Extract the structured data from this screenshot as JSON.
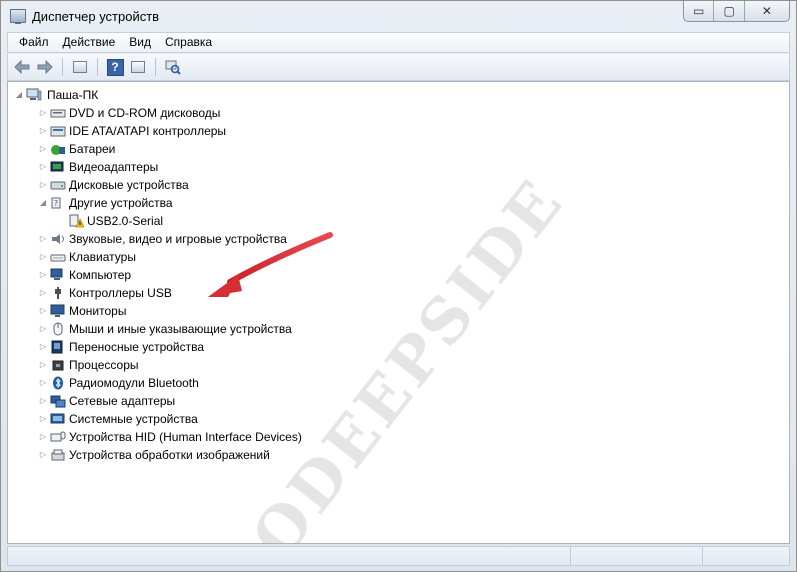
{
  "window": {
    "title": "Диспетчер устройств"
  },
  "caption_buttons": {
    "minimize": "▭",
    "maximize": "▢",
    "close": "✕"
  },
  "menu": [
    "Файл",
    "Действие",
    "Вид",
    "Справка"
  ],
  "toolbar": {
    "buttons": [
      "back-icon",
      "forward-icon",
      "properties-icon",
      "help-icon",
      "update-driver-icon",
      "scan-hardware-icon"
    ]
  },
  "tree": {
    "root": {
      "label": "Паша-ПК",
      "icon": "computer-icon",
      "expanded": true
    },
    "categories": [
      {
        "label": "DVD и CD-ROM дисководы",
        "icon": "dvd-drive-icon",
        "expanded": false
      },
      {
        "label": "IDE ATA/ATAPI контроллеры",
        "icon": "ide-controller-icon",
        "expanded": false
      },
      {
        "label": "Батареи",
        "icon": "battery-icon",
        "expanded": false
      },
      {
        "label": "Видеоадаптеры",
        "icon": "display-adapter-icon",
        "expanded": false
      },
      {
        "label": "Дисковые устройства",
        "icon": "disk-drive-icon",
        "expanded": false
      },
      {
        "label": "Другие устройства",
        "icon": "other-devices-icon",
        "expanded": true,
        "children": [
          {
            "label": "USB2.0-Serial",
            "icon": "unknown-device-warning-icon"
          }
        ]
      },
      {
        "label": "Звуковые, видео и игровые устройства",
        "icon": "speaker-icon",
        "expanded": false
      },
      {
        "label": "Клавиатуры",
        "icon": "keyboard-icon",
        "expanded": false
      },
      {
        "label": "Компьютер",
        "icon": "computer-icon",
        "expanded": false
      },
      {
        "label": "Контроллеры USB",
        "icon": "usb-icon",
        "expanded": false
      },
      {
        "label": "Мониторы",
        "icon": "monitor-icon",
        "expanded": false
      },
      {
        "label": "Мыши и иные указывающие устройства",
        "icon": "mouse-icon",
        "expanded": false
      },
      {
        "label": "Переносные устройства",
        "icon": "portable-device-icon",
        "expanded": false
      },
      {
        "label": "Процессоры",
        "icon": "processor-icon",
        "expanded": false
      },
      {
        "label": "Радиомодули Bluetooth",
        "icon": "bluetooth-icon",
        "expanded": false
      },
      {
        "label": "Сетевые адаптеры",
        "icon": "network-adapter-icon",
        "expanded": false
      },
      {
        "label": "Системные устройства",
        "icon": "system-devices-icon",
        "expanded": false
      },
      {
        "label": "Устройства HID (Human Interface Devices)",
        "icon": "hid-icon",
        "expanded": false
      },
      {
        "label": "Устройства обработки изображений",
        "icon": "imaging-device-icon",
        "expanded": false
      }
    ]
  },
  "watermark": "ODEEPSIDE",
  "colors": {
    "arrow": "#e0383e",
    "warning": "#f2c100",
    "watermark": "#6e6e6e"
  }
}
